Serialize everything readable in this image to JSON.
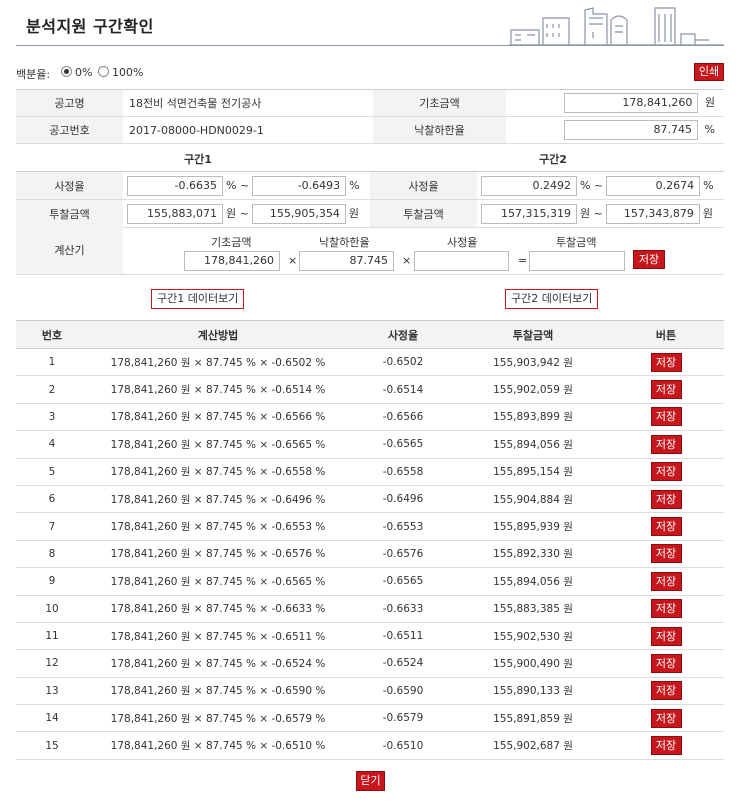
{
  "header": {
    "title": "분석지원  구간확인"
  },
  "percent": {
    "label": "백분율:",
    "options": [
      {
        "label": "0%",
        "selected": true
      },
      {
        "label": "100%",
        "selected": false
      }
    ],
    "print_label": "인쇄"
  },
  "info": {
    "notice_name_label": "공고명",
    "notice_name": "18전비 석면건축물 전기공사",
    "base_amount_label": "기초금액",
    "base_amount": "178,841,260",
    "won": "원",
    "notice_no_label": "공고번호",
    "notice_no": "2017-08000-HDN0029-1",
    "lower_rate_label": "낙찰하한율",
    "lower_rate": "87.745",
    "pct": "%"
  },
  "range1": {
    "title": "구간1",
    "rate_label": "사정율",
    "rate_from": "-0.6635",
    "rate_to": "-0.6493",
    "bid_label": "투찰금액",
    "bid_from": "155,883,071",
    "bid_to": "155,905,354"
  },
  "range2": {
    "title": "구간2",
    "rate_label": "사정율",
    "rate_from": "0.2492",
    "rate_to": "0.2674",
    "bid_label": "투찰금액",
    "bid_from": "157,315,319",
    "bid_to": "157,343,879"
  },
  "units": {
    "pct_tilde": "% ~",
    "pct": "%",
    "won_tilde": "원 ~",
    "won": "원"
  },
  "calculator": {
    "label": "계산기",
    "h_base": "기초금액",
    "h_rate": "낙찰하한율",
    "h_adj": "사정율",
    "h_bid": "투찰금액",
    "base": "178,841,260",
    "rate": "87.745",
    "adj": "",
    "bid": "",
    "times": "×",
    "equals": "=",
    "save": "저장"
  },
  "view_buttons": {
    "range1": "구간1 데이터보기",
    "range2": "구간2 데이터보기"
  },
  "table": {
    "headers": [
      "번호",
      "계산방법",
      "사정율",
      "투찰금액",
      "버튼"
    ],
    "rows": [
      {
        "no": "1",
        "method": "178,841,260 원 × 87.745 % × -0.6502 %",
        "rate": "-0.6502",
        "bid": "155,903,942 원",
        "btn": "저장"
      },
      {
        "no": "2",
        "method": "178,841,260 원 × 87.745 % × -0.6514 %",
        "rate": "-0.6514",
        "bid": "155,902,059 원",
        "btn": "저장"
      },
      {
        "no": "3",
        "method": "178,841,260 원 × 87.745 % × -0.6566 %",
        "rate": "-0.6566",
        "bid": "155,893,899 원",
        "btn": "저장"
      },
      {
        "no": "4",
        "method": "178,841,260 원 × 87.745 % × -0.6565 %",
        "rate": "-0.6565",
        "bid": "155,894,056 원",
        "btn": "저장"
      },
      {
        "no": "5",
        "method": "178,841,260 원 × 87.745 % × -0.6558 %",
        "rate": "-0.6558",
        "bid": "155,895,154 원",
        "btn": "저장"
      },
      {
        "no": "6",
        "method": "178,841,260 원 × 87.745 % × -0.6496 %",
        "rate": "-0.6496",
        "bid": "155,904,884 원",
        "btn": "저장"
      },
      {
        "no": "7",
        "method": "178,841,260 원 × 87.745 % × -0.6553 %",
        "rate": "-0.6553",
        "bid": "155,895,939 원",
        "btn": "저장"
      },
      {
        "no": "8",
        "method": "178,841,260 원 × 87.745 % × -0.6576 %",
        "rate": "-0.6576",
        "bid": "155,892,330 원",
        "btn": "저장"
      },
      {
        "no": "9",
        "method": "178,841,260 원 × 87.745 % × -0.6565 %",
        "rate": "-0.6565",
        "bid": "155,894,056 원",
        "btn": "저장"
      },
      {
        "no": "10",
        "method": "178,841,260 원 × 87.745 % × -0.6633 %",
        "rate": "-0.6633",
        "bid": "155,883,385 원",
        "btn": "저장"
      },
      {
        "no": "11",
        "method": "178,841,260 원 × 87.745 % × -0.6511 %",
        "rate": "-0.6511",
        "bid": "155,902,530 원",
        "btn": "저장"
      },
      {
        "no": "12",
        "method": "178,841,260 원 × 87.745 % × -0.6524 %",
        "rate": "-0.6524",
        "bid": "155,900,490 원",
        "btn": "저장"
      },
      {
        "no": "13",
        "method": "178,841,260 원 × 87.745 % × -0.6590 %",
        "rate": "-0.6590",
        "bid": "155,890,133 원",
        "btn": "저장"
      },
      {
        "no": "14",
        "method": "178,841,260 원 × 87.745 % × -0.6579 %",
        "rate": "-0.6579",
        "bid": "155,891,859 원",
        "btn": "저장"
      },
      {
        "no": "15",
        "method": "178,841,260 원 × 87.745 % × -0.6510 %",
        "rate": "-0.6510",
        "bid": "155,902,687 원",
        "btn": "저장"
      }
    ]
  },
  "close_label": "닫기",
  "colors": {
    "accent": "#c8161d",
    "label_bg": "#f3f3f3",
    "skyline": "#8a94a4"
  }
}
